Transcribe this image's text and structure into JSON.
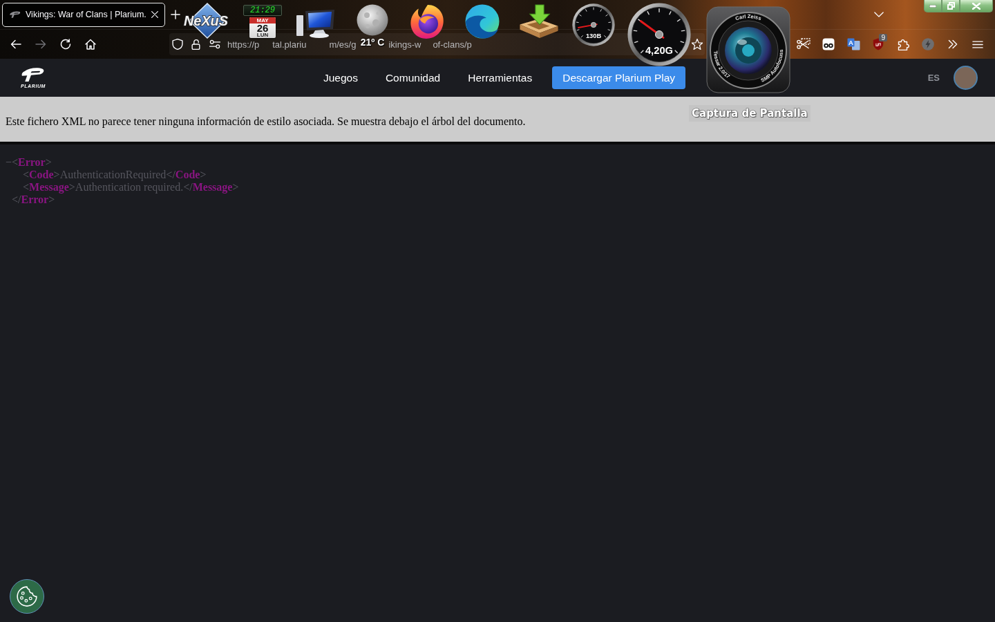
{
  "browser": {
    "tabs": [
      {
        "title": "Vikings: War of Clans | Plarium.",
        "selected": true
      }
    ],
    "nav_buttons": [
      {
        "kind": "back",
        "disabled": false
      },
      {
        "kind": "forward",
        "disabled": true
      },
      {
        "kind": "reload",
        "disabled": false
      },
      {
        "kind": "home",
        "disabled": false
      }
    ],
    "address_bar": {
      "url_fragments": [
        "https://p",
        "tal.plariu",
        "m/es/g",
        "ikings-w",
        "of-clans/p"
      ]
    },
    "extensions": [
      {
        "kind": "screenshot"
      },
      {
        "kind": "reader"
      },
      {
        "kind": "translate",
        "letter": "A"
      },
      {
        "kind": "blocker",
        "badge": "9"
      },
      {
        "kind": "extensions"
      },
      {
        "kind": "lightning"
      },
      {
        "kind": "overflow"
      },
      {
        "kind": "menu"
      }
    ]
  },
  "desktop_dock": {
    "items": [
      {
        "kind": "logo",
        "label": "NeXuS"
      },
      {
        "kind": "calendar",
        "time": "21:29",
        "month": "MAY",
        "day": "26",
        "weekday": "LUN"
      },
      {
        "kind": "computer"
      },
      {
        "kind": "weather",
        "temperature": "21º C"
      },
      {
        "kind": "fox_globe"
      },
      {
        "kind": "swirl"
      },
      {
        "kind": "download"
      },
      {
        "kind": "meter",
        "reading": "130B"
      },
      {
        "kind": "meter",
        "reading": "4,20G"
      },
      {
        "kind": "camera",
        "texts": [
          "Carl Zeiss",
          "Tessar 2.0/17",
          "SMP Autofocuss"
        ]
      }
    ],
    "tooltip": "Captura de Pantalla"
  },
  "site": {
    "logo_text": "PLARIUM",
    "nav_links": [
      "Juegos",
      "Comunidad",
      "Herramientas"
    ],
    "download_button": "Descargar Plarium Play",
    "language": "ES"
  },
  "xml_viewer": {
    "notice": "Este fichero XML no parece tener ninguna información de estilo asociada. Se muestra debajo el árbol del documento.",
    "tree": {
      "toggle": "−",
      "open_tag": [
        {
          "kind": "bracket",
          "text": "<"
        },
        {
          "kind": "tag",
          "text": "Error"
        },
        {
          "kind": "bracket",
          "text": ">"
        }
      ],
      "children": [
        {
          "tokens": [
            {
              "kind": "bracket",
              "text": "<"
            },
            {
              "kind": "tag",
              "text": "Code"
            },
            {
              "kind": "bracket",
              "text": ">"
            },
            {
              "kind": "text",
              "text": "AuthenticationRequired"
            },
            {
              "kind": "bracket",
              "text": "</"
            },
            {
              "kind": "tag",
              "text": "Code"
            },
            {
              "kind": "bracket",
              "text": ">"
            }
          ]
        },
        {
          "tokens": [
            {
              "kind": "bracket",
              "text": "<"
            },
            {
              "kind": "tag",
              "text": "Message"
            },
            {
              "kind": "bracket",
              "text": ">"
            },
            {
              "kind": "text",
              "text": "Authentication required."
            },
            {
              "kind": "bracket",
              "text": "</"
            },
            {
              "kind": "tag",
              "text": "Message"
            },
            {
              "kind": "bracket",
              "text": ">"
            }
          ]
        }
      ],
      "close_tag": [
        {
          "kind": "bracket",
          "text": "</"
        },
        {
          "kind": "tag",
          "text": "Error"
        },
        {
          "kind": "bracket",
          "text": ">"
        }
      ]
    }
  }
}
